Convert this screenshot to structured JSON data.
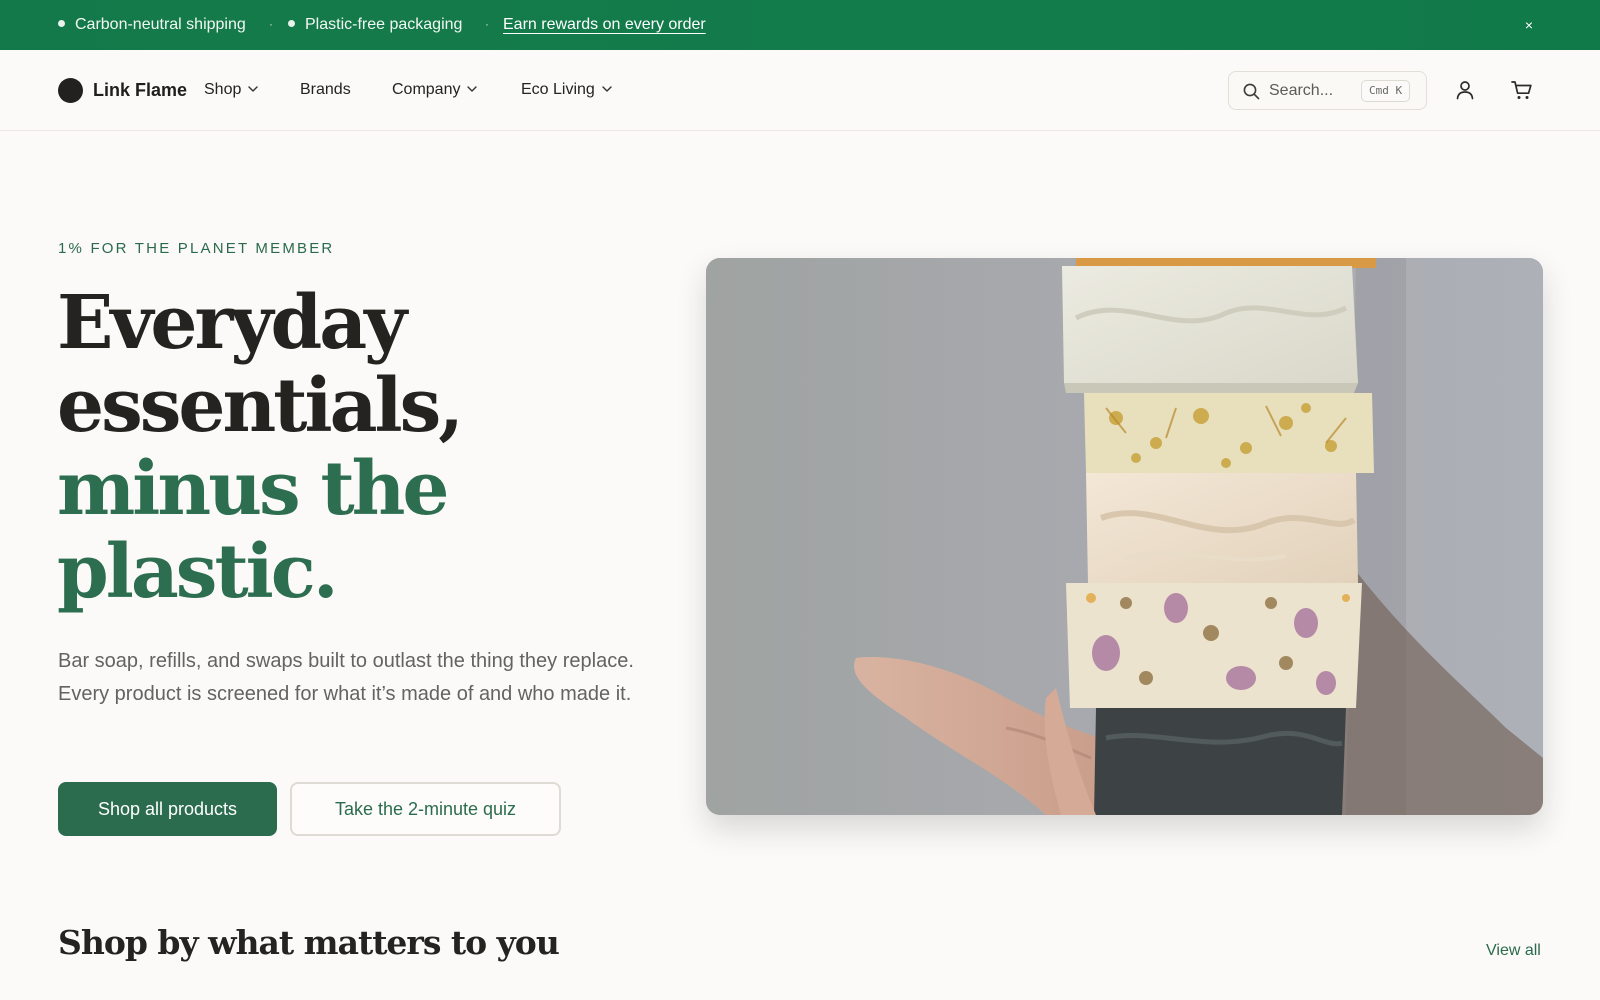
{
  "announcement": {
    "items": [
      "Carbon-neutral shipping",
      "Plastic-free packaging"
    ],
    "separator": "·",
    "link_label": "Earn rewards on every order",
    "close_label": "×"
  },
  "header": {
    "brand": "Link Flame",
    "nav": [
      {
        "label": "Shop",
        "has_dropdown": true
      },
      {
        "label": "Brands",
        "has_dropdown": false
      },
      {
        "label": "Company",
        "has_dropdown": true
      },
      {
        "label": "Eco Living",
        "has_dropdown": true
      }
    ],
    "search": {
      "placeholder": "Search...",
      "shortcut": "Cmd K",
      "icon": "search-icon"
    },
    "account_icon": "user-icon",
    "cart_icon": "cart-icon"
  },
  "hero": {
    "eyebrow": "1% FOR THE PLANET MEMBER",
    "headline": [
      "Everyday",
      "essentials,"
    ],
    "headline_accent": [
      "minus the",
      "plastic."
    ],
    "subtext": "Bar soap, refills, and swaps built to outlast the thing they replace. Every product is screened for what it’s made of and who made it.",
    "primary_cta": "Shop all products",
    "secondary_cta": "Take the 2-minute quiz",
    "image_subject": "hand holding a stack of handmade soap bars"
  },
  "section": {
    "title": "Shop by what matters to you",
    "view_all": "View all"
  },
  "colors": {
    "brand_green": "#2c6c4e",
    "announcement_bg": "#137c4b",
    "page_bg": "#fbfaf8",
    "text_dark": "#24231f"
  }
}
